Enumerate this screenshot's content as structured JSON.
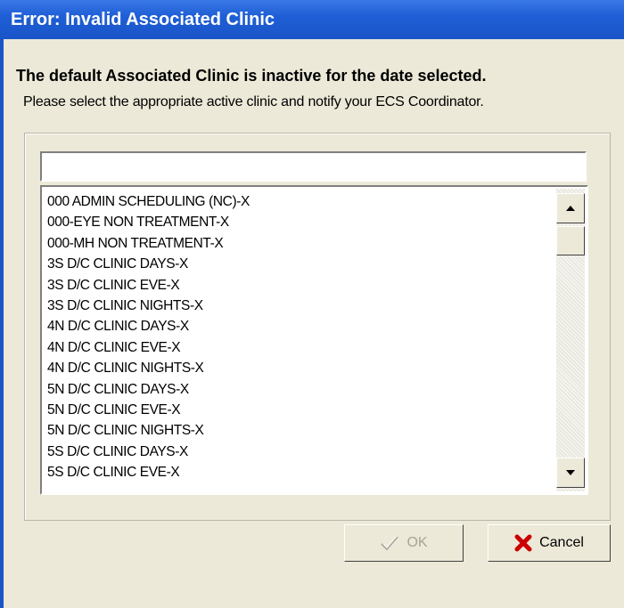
{
  "window": {
    "title": "Error: Invalid Associated Clinic"
  },
  "message": {
    "heading": "The default Associated Clinic is inactive for the date selected.",
    "detail": "Please select the appropriate active clinic and notify your ECS Coordinator."
  },
  "search": {
    "value": ""
  },
  "clinics": [
    "000 ADMIN SCHEDULING (NC)-X",
    "000-EYE NON TREATMENT-X",
    "000-MH NON TREATMENT-X",
    "3S D/C CLINIC DAYS-X",
    "3S D/C CLINIC EVE-X",
    "3S D/C CLINIC NIGHTS-X",
    "4N D/C CLINIC DAYS-X",
    "4N D/C CLINIC EVE-X",
    "4N D/C CLINIC NIGHTS-X",
    "5N D/C CLINIC DAYS-X",
    "5N D/C CLINIC EVE-X",
    "5N D/C CLINIC NIGHTS-X",
    "5S D/C CLINIC DAYS-X",
    "5S D/C CLINIC EVE-X"
  ],
  "buttons": {
    "ok": {
      "label": "OK",
      "enabled": false,
      "icon": "checkmark-icon"
    },
    "cancel": {
      "label": "Cancel",
      "enabled": true,
      "icon": "red-x-icon"
    }
  },
  "colors": {
    "title_bar": "#1a54c8",
    "dialog_bg": "#ece9d8",
    "cancel_icon": "#cc0000",
    "disabled_text": "#a8a598"
  }
}
